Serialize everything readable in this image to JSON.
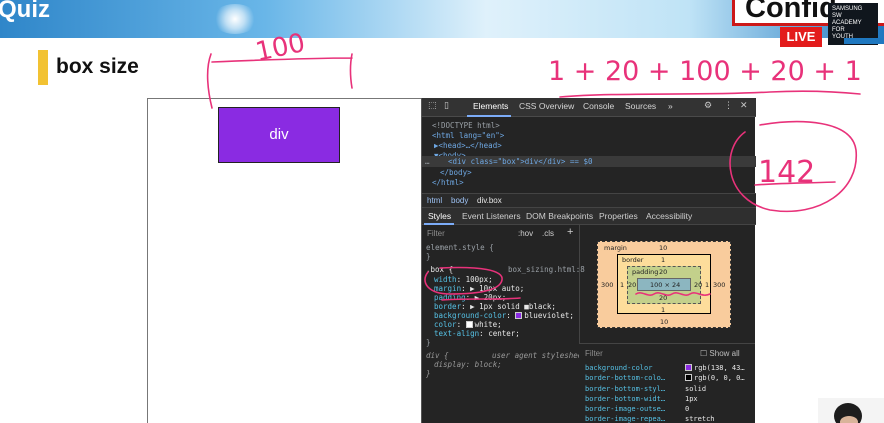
{
  "slide": {
    "title": "Quiz",
    "confidential": "Confid",
    "live_badge": "LIVE",
    "academy_badge": [
      "SAMSUNG",
      "SW",
      "ACADEMY",
      "FOR",
      "YOUTH"
    ],
    "section_title": "box size",
    "accent_color": "#f2c232"
  },
  "preview": {
    "div_label": "div",
    "div_color": "#8a2be2"
  },
  "devtools": {
    "tabs": [
      "Elements",
      "CSS Overview",
      "Console",
      "Sources",
      "»"
    ],
    "active_tab": "Elements",
    "dom": {
      "doctype": "<!DOCTYPE html>",
      "html_open": "<html lang=\"en\">",
      "head": "▶<head>…</head>",
      "body_open": "▼<body>",
      "selected": "<div class=\"box\">div</div> == $0",
      "body_close": "</body>",
      "html_close": "</html>"
    },
    "breadcrumbs": [
      "html",
      "body",
      "div.box"
    ],
    "subtabs": [
      "Styles",
      "Event Listeners",
      "DOM Breakpoints",
      "Properties",
      "Accessibility"
    ],
    "filter_placeholder": "Filter",
    "hov": ":hov",
    "cls": ".cls",
    "plus": "+",
    "element_style": "element.style {",
    "close_brace": "}",
    "rule_selector": ".box {",
    "rule_source": "box_sizing.html:8",
    "rule_props": [
      {
        "prop": "width",
        "val": "100px;"
      },
      {
        "prop": "margin",
        "val": "▶ 10px auto;"
      },
      {
        "prop": "padding",
        "val": "▶ 20px;"
      },
      {
        "prop": "border",
        "val": "▶ 1px solid ■black;"
      },
      {
        "prop": "background-color",
        "val": "blueviolet;"
      },
      {
        "prop": "color",
        "val": "white;"
      },
      {
        "prop": "text-align",
        "val": "center;"
      }
    ],
    "ua_selector": "div {",
    "ua_source": "user agent stylesheet",
    "ua_prop": "display: block;",
    "box_model": {
      "margin_label": "margin",
      "margin_top": "10",
      "margin_bottom": "10",
      "margin_left": "300",
      "margin_right": "300",
      "border_label": "border",
      "border_top": "1",
      "border_bottom": "1",
      "border_left": "1",
      "border_right": "1",
      "padding_label": "padding",
      "padding_top": "20",
      "padding_bottom": "20",
      "padding_left": "20",
      "padding_right": "20",
      "content": "100 × 24",
      "below": "16"
    },
    "computed_filter": "Filter",
    "show_all": "Show all",
    "computed": [
      {
        "prop": "background-color",
        "val": "rgb(138, 43…"
      },
      {
        "prop": "border-bottom-colo…",
        "val": "rgb(0, 0, 0…"
      },
      {
        "prop": "border-bottom-styl…",
        "val": "solid"
      },
      {
        "prop": "border-bottom-widt…",
        "val": "1px"
      },
      {
        "prop": "border-image-outse…",
        "val": "0"
      },
      {
        "prop": "border-image-repea…",
        "val": "stretch"
      }
    ]
  },
  "annotations": {
    "width_note": "100",
    "sum_note": "1 + 20 + 100 + 20 + 1",
    "result_note": "142",
    "ink_color": "#e8327a"
  }
}
